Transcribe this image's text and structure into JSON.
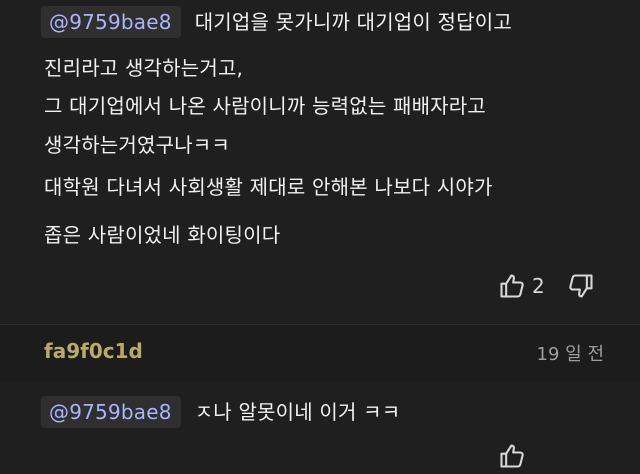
{
  "comment": {
    "mention": "@9759bae8",
    "first_line": "대기업을 못가니까 대기업이 정답이고",
    "lines": [
      "진리라고 생각하는거고,",
      "그 대기업에서 나온 사람이니까 능력없는 패배자라고",
      "생각하는거였구나ㅋㅋ",
      "대학원 다녀서 사회생활 제대로 안해본 나보다 시야가",
      "좁은 사람이었네 화이팅이다"
    ],
    "like_count": "2"
  },
  "reply": {
    "author": "fa9f0c1d",
    "time": "19 일 전",
    "mention": "@9759bae8",
    "text": "ㅈ나 알못이네 이거 ㅋㅋ"
  },
  "colors": {
    "background": "#1f1f1f",
    "mention_text": "#aab4ff",
    "author": "#b9a96c",
    "text": "#f1f1f1"
  }
}
